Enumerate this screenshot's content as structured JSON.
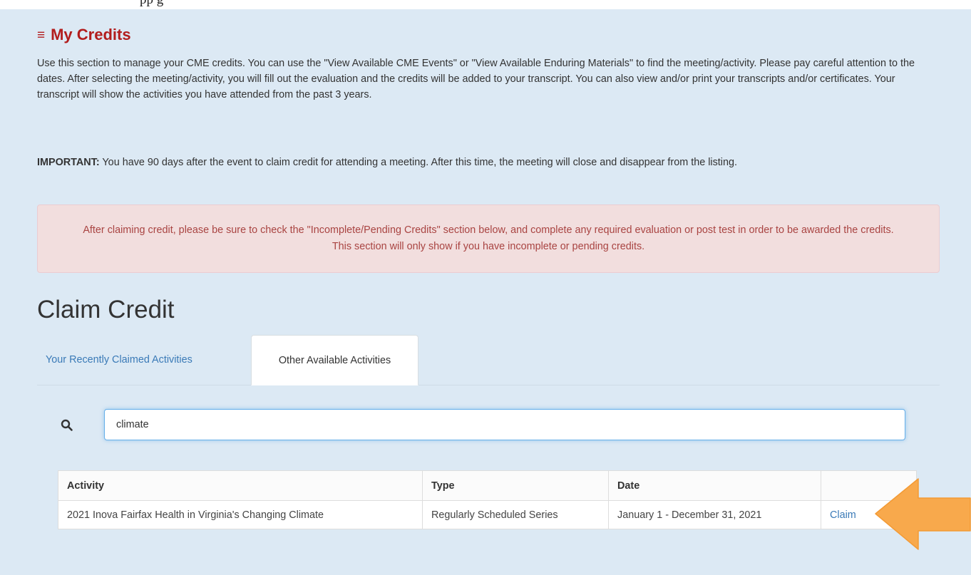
{
  "top_fragment": "pp                                                              g",
  "section": {
    "title": "My Credits",
    "icon": "menu-icon"
  },
  "intro": {
    "paragraph": "Use this section to manage your CME credits. You can use the \"View Available CME Events\" or \"View Available Enduring Materials\" to find the meeting/activity. Please pay careful attention to the dates. After selecting the meeting/activity, you will fill out the evaluation and the credits will be added to your transcript. You can also view and/or print your transcripts and/or certificates. Your transcript will show the activities you have attended from the past 3 years.",
    "important_label": "IMPORTANT:",
    "important_text": " You have 90 days after the event to claim credit for attending a meeting. After this time, the meeting will close and disappear from the listing."
  },
  "alert": {
    "text": "After claiming credit, please be sure to check the \"Incomplete/Pending Credits\" section below, and complete any required evaluation or post test in order to be awarded the credits. This section will only show if you have incomplete or pending credits."
  },
  "claim": {
    "heading": "Claim Credit",
    "tabs": [
      {
        "label": "Your Recently Claimed Activities",
        "active": false
      },
      {
        "label": "Other Available Activities",
        "active": true
      }
    ],
    "search": {
      "icon": "search-icon",
      "value": "climate"
    },
    "table": {
      "headers": [
        "Activity",
        "Type",
        "Date",
        ""
      ],
      "rows": [
        {
          "activity": "2021 Inova Fairfax Health in Virginia's Changing Climate",
          "type": "Regularly Scheduled Series",
          "date": "January 1 - December 31, 2021",
          "action": "Claim"
        }
      ]
    }
  },
  "colors": {
    "page_bg": "#dce9f4",
    "title_red": "#b21d1d",
    "link_blue": "#3a7ab7",
    "alert_bg": "#f2dede",
    "alert_text": "#a94442",
    "arrow_orange": "#f8a94c"
  },
  "annotation": {
    "icon": "arrow-icon"
  }
}
